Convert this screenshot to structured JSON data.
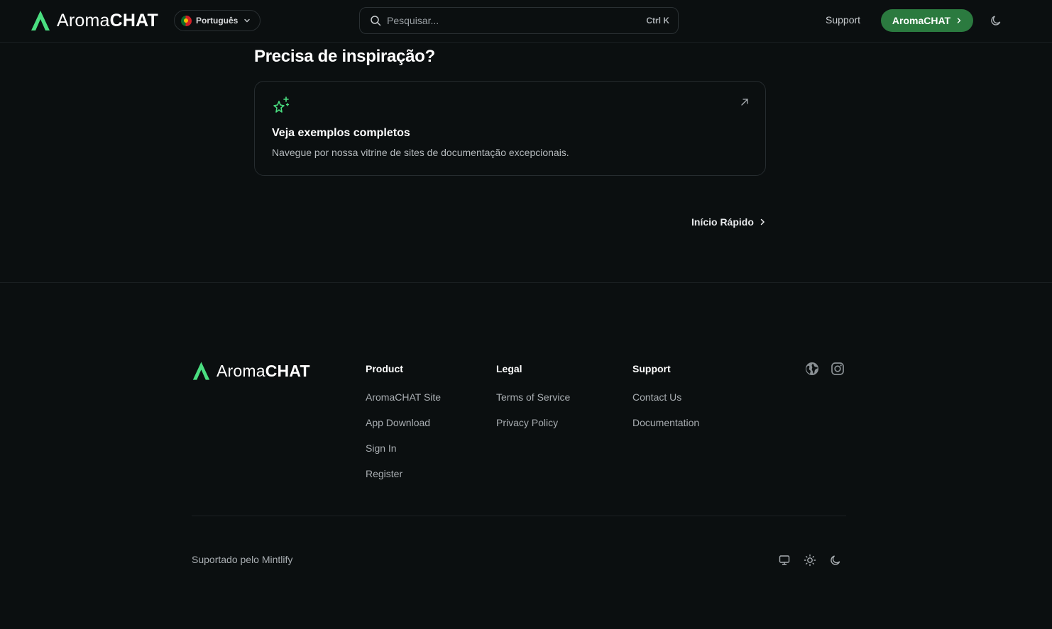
{
  "header": {
    "brand_light": "Aroma",
    "brand_bold": "CHAT",
    "language": "Português",
    "search_placeholder": "Pesquisar...",
    "search_shortcut": "Ctrl K",
    "support_label": "Support",
    "cta_label": "AromaCHAT"
  },
  "main": {
    "heading": "Precisa de inspiração?",
    "card": {
      "title": "Veja exemplos completos",
      "description": "Navegue por nossa vitrine de sites de documentação excepcionais."
    },
    "next_label": "Início Rápido"
  },
  "footer": {
    "brand_light": "Aroma",
    "brand_bold": "CHAT",
    "columns": [
      {
        "title": "Product",
        "links": [
          "AromaCHAT Site",
          "App Download",
          "Sign In",
          "Register"
        ]
      },
      {
        "title": "Legal",
        "links": [
          "Terms of Service",
          "Privacy Policy"
        ]
      },
      {
        "title": "Support",
        "links": [
          "Contact Us",
          "Documentation"
        ]
      }
    ],
    "powered_by": "Suportado pelo Mintlify"
  },
  "colors": {
    "accent": "#2b7a3f",
    "logo_green": "#4ade80",
    "background": "#0b0f10"
  }
}
